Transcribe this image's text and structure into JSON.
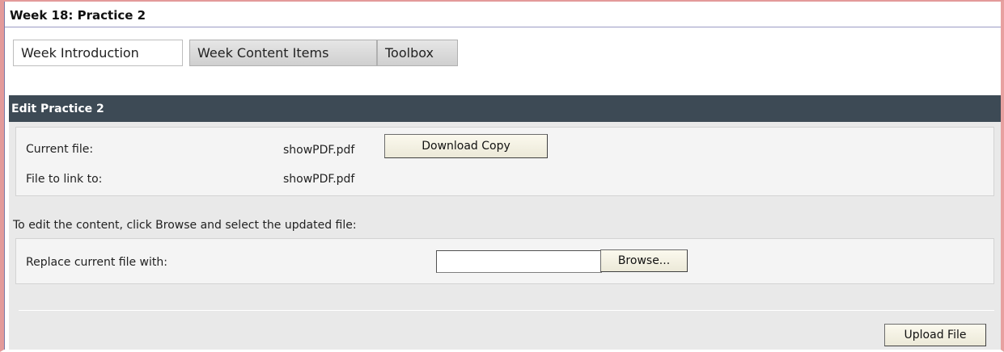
{
  "page": {
    "title": "Week 18: Practice 2"
  },
  "tabs": [
    {
      "label": "Week Introduction",
      "active": true
    },
    {
      "label": "Week Content Items",
      "active": false
    },
    {
      "label": "Toolbox",
      "active": false
    }
  ],
  "edit_section": {
    "header": "Edit Practice 2",
    "current_file_label": "Current file:",
    "current_file_value": "showPDF.pdf",
    "download_button": "Download Copy",
    "link_file_label": "File to link to:",
    "link_file_value": "showPDF.pdf",
    "instruction": "To edit the content, click Browse and select the updated file:",
    "replace_label": "Replace current file with:",
    "replace_input_value": "",
    "browse_button": "Browse...",
    "upload_button": "Upload File"
  },
  "colors": {
    "header_bg": "#3d4a55",
    "panel_bg": "#e9e9e9",
    "frame_border": "#e39a9a"
  }
}
